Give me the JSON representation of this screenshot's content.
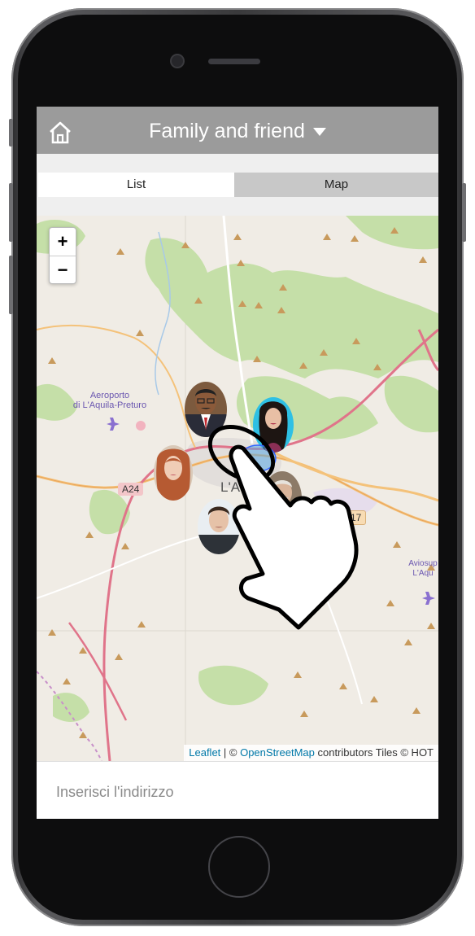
{
  "header": {
    "title": "Family and friend",
    "home_icon": "home-icon",
    "dropdown_icon": "caret-down-icon"
  },
  "tabs": [
    {
      "label": "List",
      "active": true
    },
    {
      "label": "Map",
      "active": false
    }
  ],
  "map": {
    "zoom_in_label": "+",
    "zoom_out_label": "−",
    "labels": {
      "airport_line1": "Aeroporto",
      "airport_line2": "di L'Aquila-Preturo",
      "city": "L'Aquila",
      "aviosup_line1": "Aviosup",
      "aviosup_line2": "L'Aqu"
    },
    "road_shields": [
      "A24",
      "SS17"
    ],
    "attribution": {
      "leaflet": "Leaflet",
      "separator": " | © ",
      "osm": "OpenStreetMap",
      "rest": " contributors Tiles © HOT"
    },
    "avatars": [
      "avatar-man-glasses",
      "avatar-woman-dark-hair",
      "avatar-woman-red-hair",
      "avatar-older-man",
      "avatar-young-man"
    ],
    "gesture_icon": "hand-pointer-icon"
  },
  "address": {
    "placeholder": "Inserisci l'indirizzo",
    "value": ""
  }
}
